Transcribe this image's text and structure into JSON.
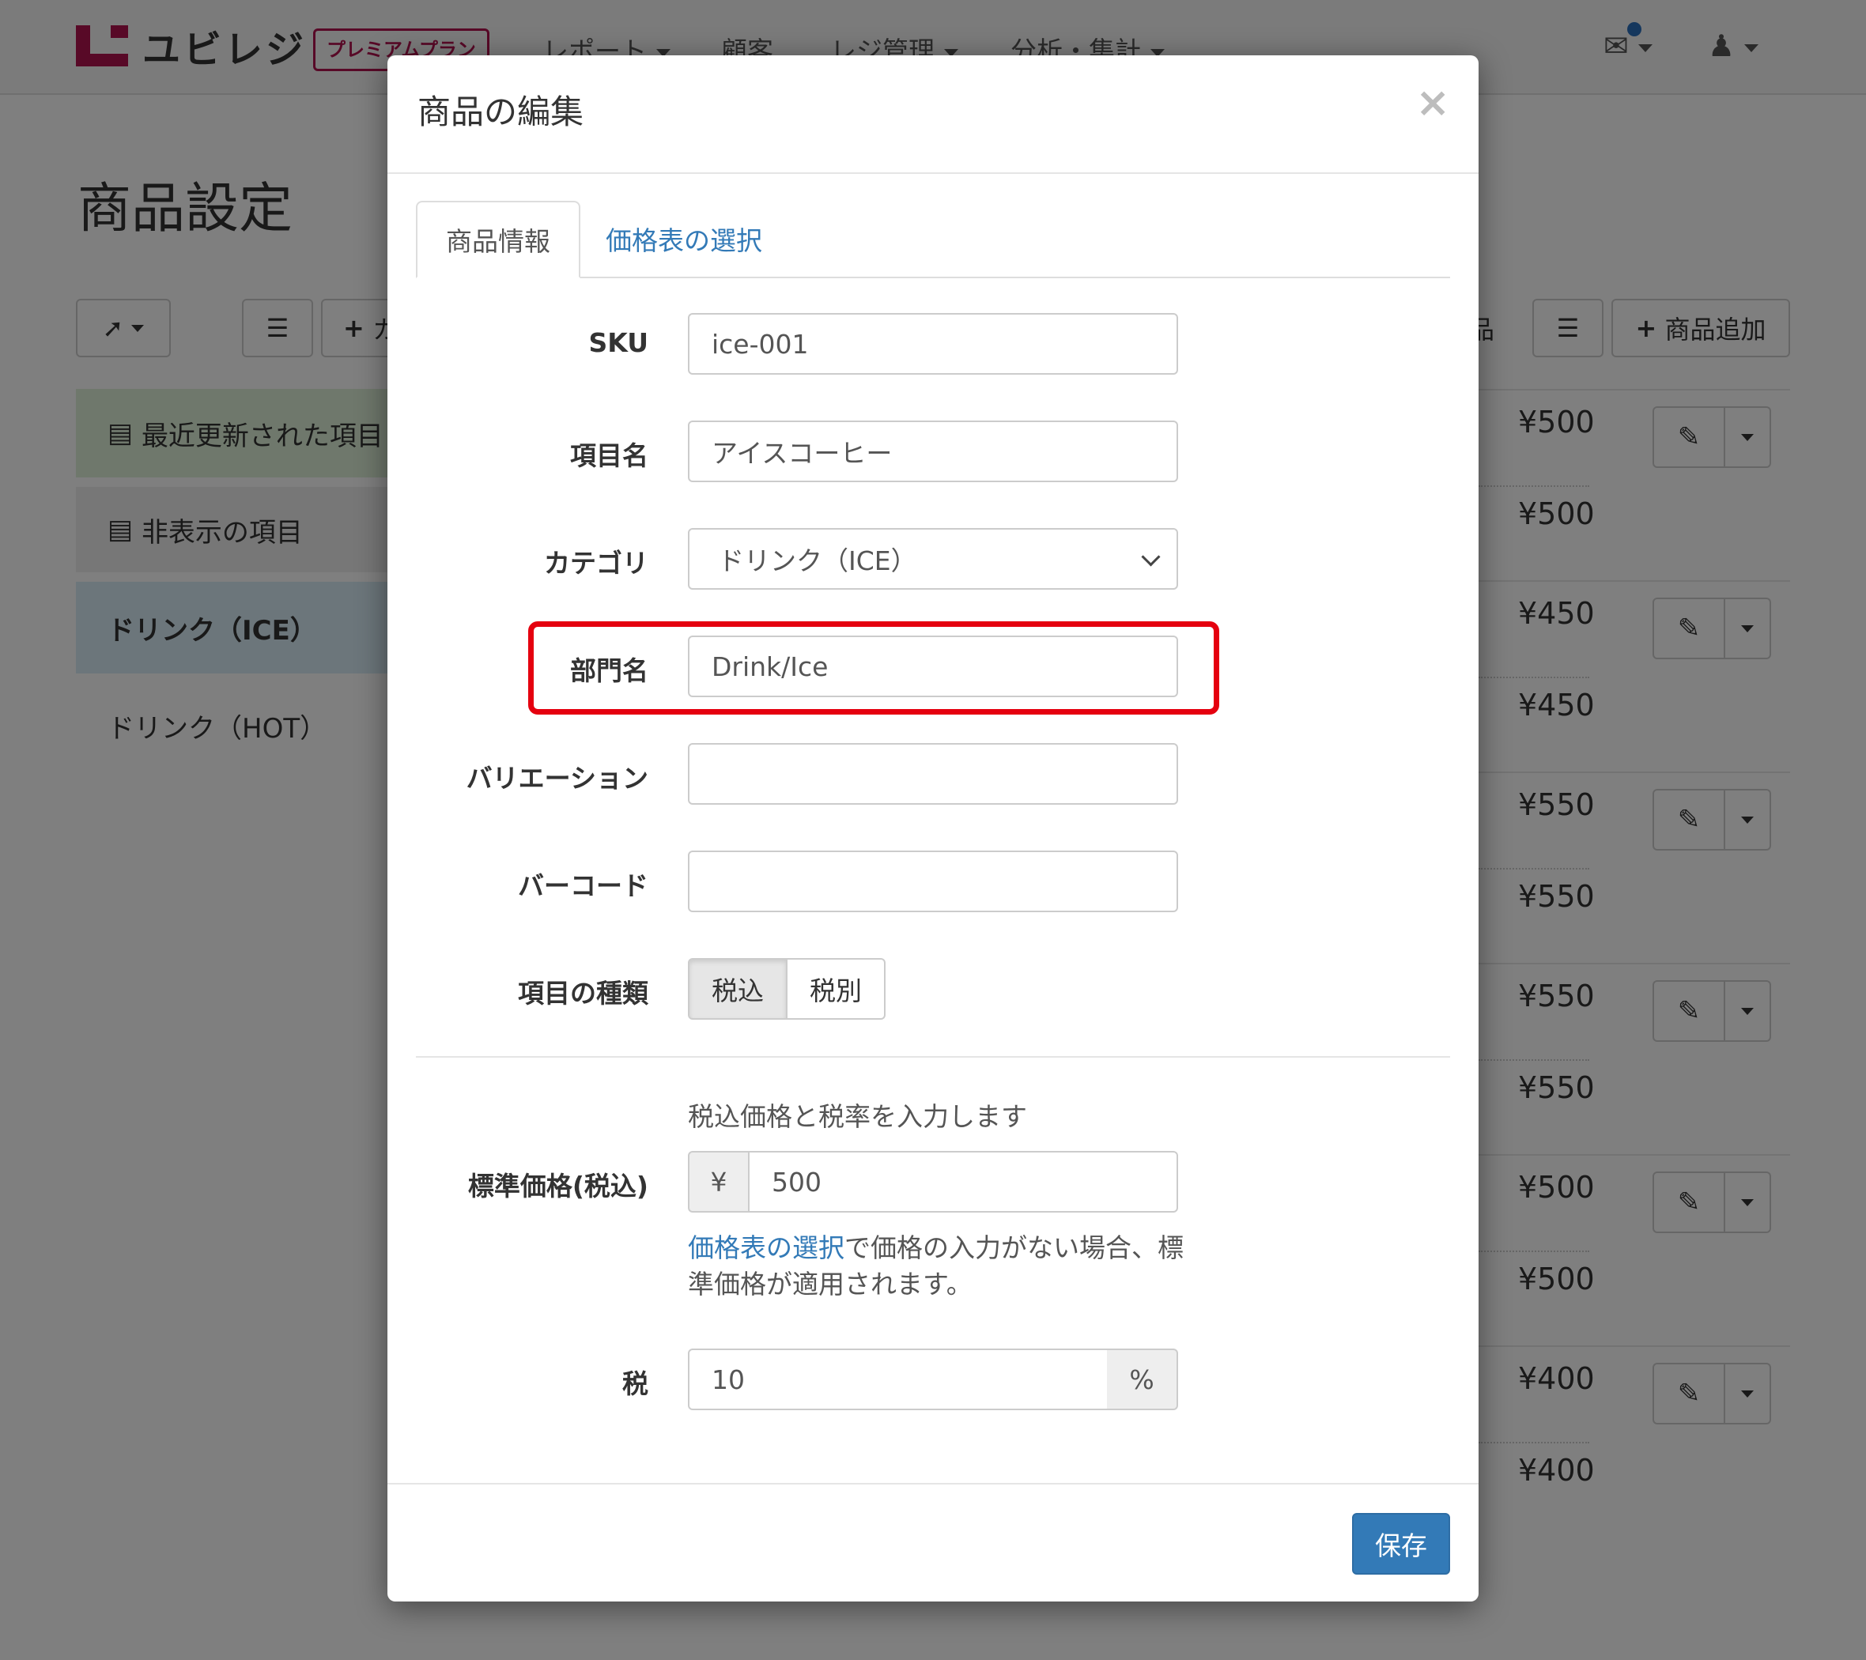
{
  "navbar": {
    "logo_text": "ユビレジ",
    "plan": "プレミアムプラン",
    "items": [
      "レポート",
      "顧客",
      "レジ管理",
      "分析・集計"
    ]
  },
  "page": {
    "title": "商品設定",
    "toolbar_add_partial": "カ",
    "right_label_partial": "品",
    "add_item_label": "商品追加"
  },
  "categories": [
    {
      "label": "最近更新された項目"
    },
    {
      "label": "非表示の項目"
    },
    {
      "label": "ドリンク（ICE）"
    },
    {
      "label": "ドリンク（HOT）"
    }
  ],
  "prices": [
    "¥500",
    "¥500",
    "¥450",
    "¥450",
    "¥550",
    "¥550",
    "¥550",
    "¥550",
    "¥500",
    "¥500",
    "¥400",
    "¥400"
  ],
  "modal": {
    "title": "商品の編集",
    "close": "×",
    "tabs": [
      "商品情報",
      "価格表の選択"
    ],
    "fields": {
      "sku": {
        "label": "SKU",
        "value": "ice-001"
      },
      "name": {
        "label": "項目名",
        "value": "アイスコーヒー"
      },
      "category": {
        "label": "カテゴリ",
        "value": "ドリンク（ICE）"
      },
      "department": {
        "label": "部門名",
        "value": "Drink/Ice"
      },
      "variation": {
        "label": "バリエーション",
        "value": ""
      },
      "barcode": {
        "label": "バーコード",
        "value": ""
      },
      "item_type": {
        "label": "項目の種類",
        "options": [
          "税込",
          "税別"
        ],
        "selected": "税込"
      }
    },
    "price_help": "税込価格と税率を入力します",
    "standard_price": {
      "label": "標準価格(税込)",
      "prefix": "¥",
      "value": "500"
    },
    "price_note_link": "価格表の選択",
    "price_note_line1": "で価格の入力がない場合、標",
    "price_note_line2": "準価格が適用されます。",
    "tax": {
      "label": "税",
      "value": "10",
      "suffix": "%"
    },
    "save_label": "保存"
  },
  "colors": {
    "brand": "#b0124f",
    "primary": "#337ab7",
    "highlight": "#e5000f"
  }
}
